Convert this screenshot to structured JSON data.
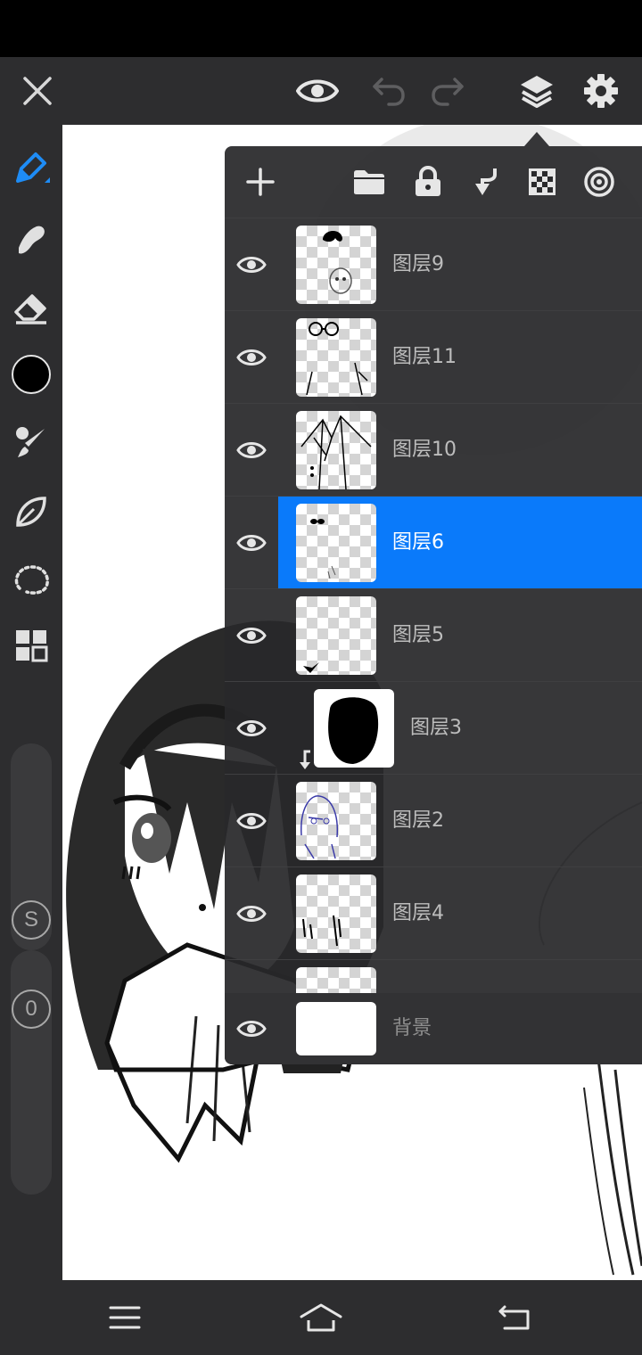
{
  "app": {
    "accent_color": "#0a7afa",
    "toolbar_bg": "#2d2d2f"
  },
  "top_toolbar": {
    "icons": [
      "close-icon",
      "eye-icon",
      "undo-icon",
      "redo-icon",
      "layers-icon",
      "gear-icon"
    ]
  },
  "left_toolbar": {
    "tools": [
      "pen-icon",
      "smudge-icon",
      "eraser-icon",
      "color-swatch",
      "brush-icon",
      "leaf-icon",
      "lasso-icon",
      "grid-icon"
    ],
    "current_color": "#000000",
    "size_label": "S",
    "opacity_label": "0"
  },
  "layers_panel": {
    "header_icons": [
      "add-icon",
      "folder-icon",
      "lock-icon",
      "merge-down-icon",
      "transparency-icon",
      "target-icon"
    ],
    "layers": [
      {
        "name": "图层9",
        "visible": true,
        "selected": false
      },
      {
        "name": "图层11",
        "visible": true,
        "selected": false
      },
      {
        "name": "图层10",
        "visible": true,
        "selected": false
      },
      {
        "name": "图层6",
        "visible": true,
        "selected": true
      },
      {
        "name": "图层5",
        "visible": true,
        "selected": false
      },
      {
        "name": "图层3",
        "visible": true,
        "selected": false,
        "clipped": true
      },
      {
        "name": "图层2",
        "visible": true,
        "selected": false
      },
      {
        "name": "图层4",
        "visible": true,
        "selected": false
      }
    ],
    "background_layer": {
      "name": "背景",
      "visible": true
    }
  },
  "bottom_nav": {
    "icons": [
      "menu-icon",
      "home-icon",
      "back-icon"
    ]
  }
}
